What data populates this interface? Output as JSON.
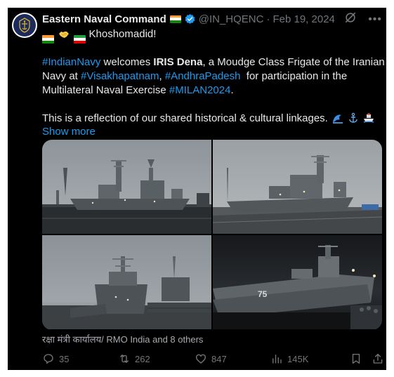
{
  "tweet": {
    "author_name": "Eastern Naval Command",
    "handle": "@IN_HQENC",
    "separator": "·",
    "date": "Feb 19, 2024",
    "greeting": "Khoshomadid!",
    "line2_tag1": "#IndianNavy",
    "line2_text1": " welcomes ",
    "line2_bold": "IRIS Dena",
    "line2_text2": ", a Moudge Class Frigate of the Iranian",
    "line3_text1": "Navy at ",
    "line3_tag1": "#Visakhapatnam",
    "line3_text2": ", ",
    "line3_tag2": "#AndhraPadesh",
    "line3_text3": "  for participation in the",
    "line4_text1": "Multilateral Naval Exercise ",
    "line4_tag1": "#MILAN2024",
    "line4_text2": ".",
    "line5_text": "This is a reflection of our shared historical & cultural linkages.",
    "show_more": "Show more",
    "caption": "रक्षा मंत्री कार्यालय/ RMO India and 8 others"
  },
  "media": [
    {
      "name": "photo-1",
      "alt": "Ship at harbor, dusk"
    },
    {
      "name": "photo-2",
      "alt": "Ship at pier"
    },
    {
      "name": "photo-3",
      "alt": "Ship bow close-up"
    },
    {
      "name": "photo-4",
      "alt": "Ship at night"
    }
  ],
  "actions": {
    "replies": "35",
    "reposts": "262",
    "likes": "847",
    "views": "145K"
  },
  "icons": {
    "verified": "verified-badge-icon",
    "grok": "grok-icon",
    "more": "more-icon",
    "reply": "reply-icon",
    "repost": "repost-icon",
    "like": "heart-icon",
    "views": "views-icon",
    "bookmark": "bookmark-icon",
    "share": "share-icon"
  },
  "colors": {
    "background": "#000000",
    "text": "#e7e9ea",
    "muted": "#71767b",
    "link": "#1d9bf0",
    "verified": "#1d9bf0"
  }
}
